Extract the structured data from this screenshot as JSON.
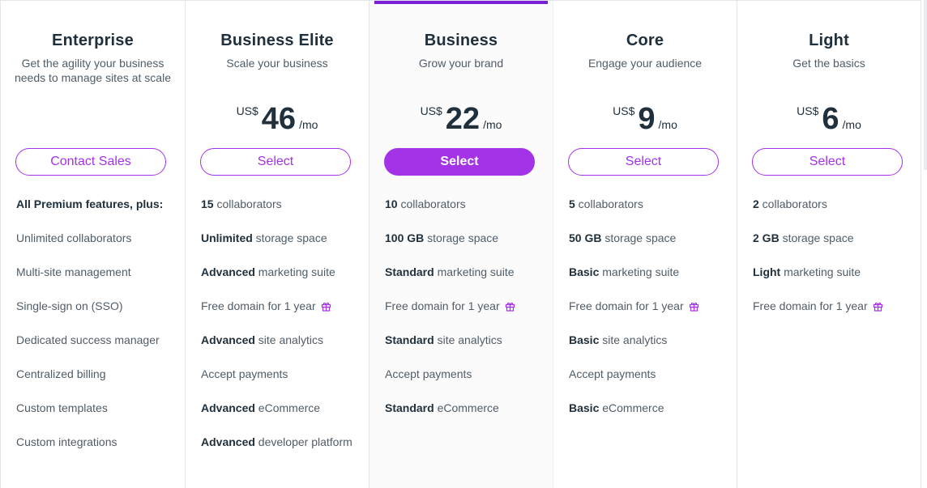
{
  "plans": [
    {
      "name": "Enterprise",
      "tagline": "Get the agility your business needs to manage sites at scale",
      "button": "Contact Sales",
      "features": [
        {
          "bold": "",
          "text": "All Premium features, plus:",
          "heading": true
        },
        {
          "bold": "",
          "text": "Unlimited collaborators"
        },
        {
          "bold": "",
          "text": "Multi-site management"
        },
        {
          "bold": "",
          "text": "Single-sign on (SSO)"
        },
        {
          "bold": "",
          "text": "Dedicated success manager"
        },
        {
          "bold": "",
          "text": "Centralized billing"
        },
        {
          "bold": "",
          "text": "Custom templates"
        },
        {
          "bold": "",
          "text": "Custom integrations"
        }
      ]
    },
    {
      "name": "Business Elite",
      "tagline": "Scale your business",
      "currency": "US$",
      "amount": "46",
      "period": "/mo",
      "button": "Select",
      "features": [
        {
          "bold": "15",
          "text": " collaborators"
        },
        {
          "bold": "Unlimited",
          "text": " storage space"
        },
        {
          "bold": "Advanced",
          "text": " marketing suite"
        },
        {
          "bold": "",
          "text": "Free domain for 1 year",
          "gift": true
        },
        {
          "bold": "Advanced",
          "text": " site analytics"
        },
        {
          "bold": "",
          "text": "Accept payments"
        },
        {
          "bold": "Advanced",
          "text": " eCommerce"
        },
        {
          "bold": "Advanced",
          "text": " developer platform"
        }
      ]
    },
    {
      "name": "Business",
      "tagline": "Grow your brand",
      "currency": "US$",
      "amount": "22",
      "period": "/mo",
      "button": "Select",
      "highlight": true,
      "features": [
        {
          "bold": "10",
          "text": " collaborators"
        },
        {
          "bold": "100 GB",
          "text": " storage space"
        },
        {
          "bold": "Standard",
          "text": " marketing suite"
        },
        {
          "bold": "",
          "text": "Free domain for 1 year",
          "gift": true
        },
        {
          "bold": "Standard",
          "text": " site analytics"
        },
        {
          "bold": "",
          "text": "Accept payments"
        },
        {
          "bold": "Standard",
          "text": " eCommerce"
        }
      ]
    },
    {
      "name": "Core",
      "tagline": "Engage your audience",
      "currency": "US$",
      "amount": "9",
      "period": "/mo",
      "button": "Select",
      "features": [
        {
          "bold": "5",
          "text": " collaborators"
        },
        {
          "bold": "50 GB",
          "text": " storage space"
        },
        {
          "bold": "Basic",
          "text": " marketing suite"
        },
        {
          "bold": "",
          "text": "Free domain for 1 year",
          "gift": true
        },
        {
          "bold": "Basic",
          "text": " site analytics"
        },
        {
          "bold": "",
          "text": "Accept payments"
        },
        {
          "bold": "Basic",
          "text": " eCommerce"
        }
      ]
    },
    {
      "name": "Light",
      "tagline": "Get the basics",
      "currency": "US$",
      "amount": "6",
      "period": "/mo",
      "button": "Select",
      "features": [
        {
          "bold": "2",
          "text": " collaborators"
        },
        {
          "bold": "2 GB",
          "text": " storage space"
        },
        {
          "bold": "Light",
          "text": " marketing suite"
        },
        {
          "bold": "",
          "text": "Free domain for 1 year",
          "gift": true
        }
      ]
    }
  ],
  "colors": {
    "accent": "#a432e6",
    "highlight_bar": "#7a1fd6",
    "text": "#20303c",
    "muted": "#505c66"
  },
  "icons": {
    "gift": "gift-icon"
  }
}
